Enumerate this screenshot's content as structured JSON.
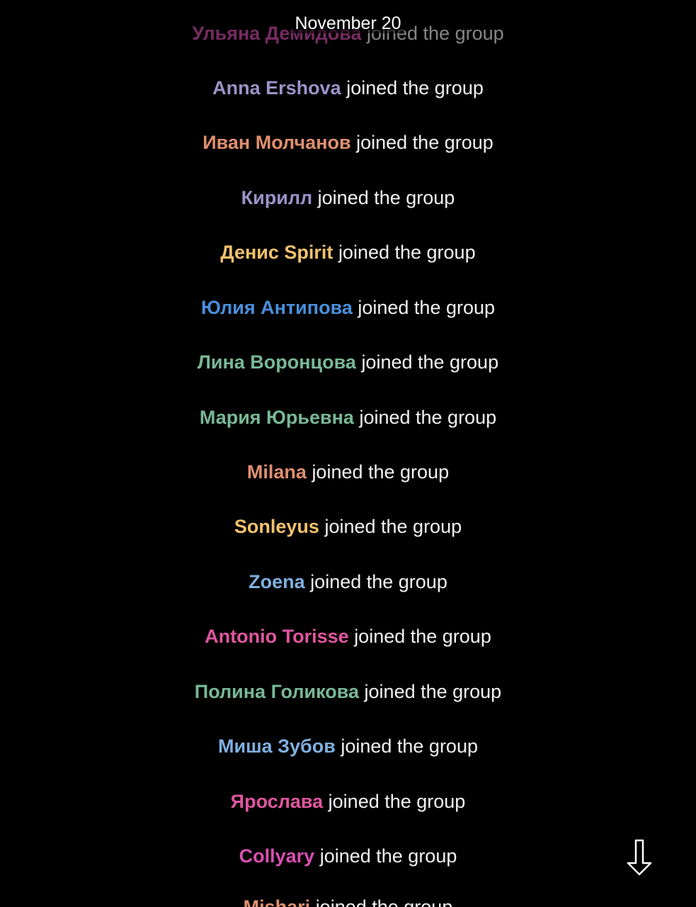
{
  "date_header": "November 20",
  "events": [
    {
      "name": "Ульяна Демидова",
      "action": "joined the group",
      "color": "#d94fb2"
    },
    {
      "name": "Anna Ershova",
      "action": "joined the group",
      "color": "#9b93c9"
    },
    {
      "name": "Иван Молчанов",
      "action": "joined the group",
      "color": "#e0906e"
    },
    {
      "name": "Кирилл",
      "action": "joined the group",
      "color": "#9b93c9"
    },
    {
      "name": "Денис Spirit",
      "action": "joined the group",
      "color": "#f2c26b"
    },
    {
      "name": "Юлия Антипова",
      "action": "joined the group",
      "color": "#4a8fdc"
    },
    {
      "name": "Лина Воронцова",
      "action": "joined the group",
      "color": "#79b896"
    },
    {
      "name": "Мария Юрьевна",
      "action": "joined the group",
      "color": "#79b896"
    },
    {
      "name": "Milana",
      "action": "joined the group",
      "color": "#e0906e"
    },
    {
      "name": "Sonleyus",
      "action": "joined the group",
      "color": "#f2c26b"
    },
    {
      "name": "Zoena",
      "action": "joined the group",
      "color": "#7fb0e0"
    },
    {
      "name": "Antonio Torisse",
      "action": "joined the group",
      "color": "#e0569f"
    },
    {
      "name": "Полина Голикова",
      "action": "joined the group",
      "color": "#79b896"
    },
    {
      "name": "Миша Зубов",
      "action": "joined the group",
      "color": "#7fb0e0"
    },
    {
      "name": "Ярослава",
      "action": "joined the group",
      "color": "#e0569f"
    },
    {
      "name": "Collyary",
      "action": "joined the group",
      "color": "#d94fb2"
    },
    {
      "name": "Mishari",
      "action": "joined the group",
      "color": "#e0906e"
    }
  ],
  "scroll_button_icon": "arrow-down-icon"
}
